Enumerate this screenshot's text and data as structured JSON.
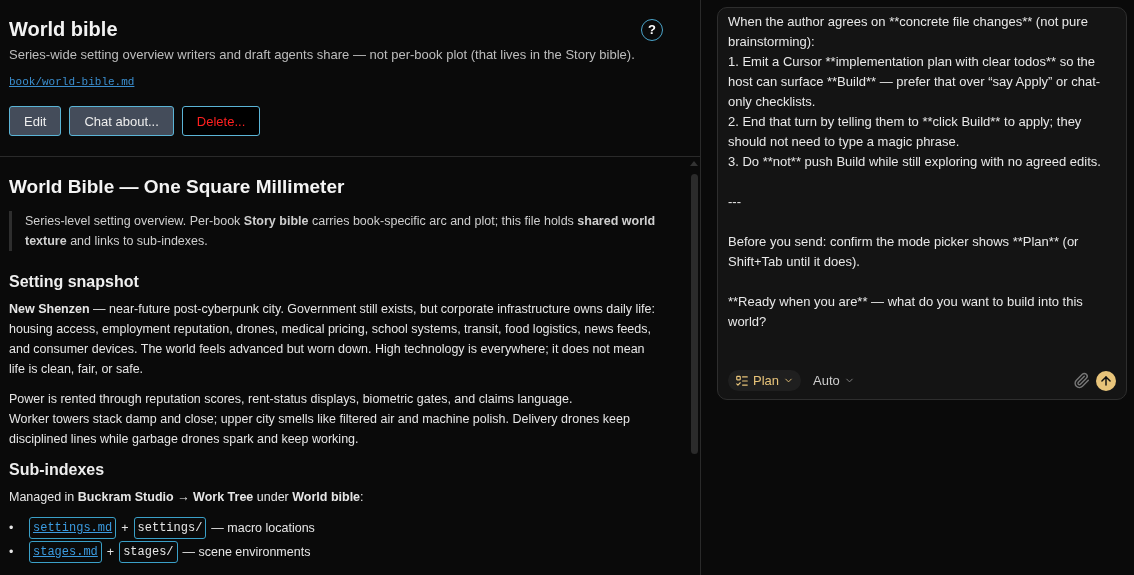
{
  "header": {
    "title": "World bible",
    "subtitle": "Series-wide setting overview writers and draft agents share — not per-book plot (that lives in the Story bible).",
    "path": "book/world-bible.md",
    "help": "?",
    "buttons": [
      {
        "label": "Edit",
        "kind": "normal"
      },
      {
        "label": "Chat about...",
        "kind": "normal"
      },
      {
        "label": "Delete...",
        "kind": "danger"
      }
    ]
  },
  "document": {
    "title": "World Bible — One Square Millimeter",
    "blocks": [
      {
        "kind": "quote",
        "text": "Series-level setting overview. Per-book **Story bible** carries book-specific arc and plot; this file holds **shared world texture** and links to sub-indexes."
      },
      {
        "kind": "heading",
        "text": "Setting snapshot"
      },
      {
        "kind": "paragraph",
        "text": "**New Shenzen** — near-future post-cyberpunk city. Government still exists, but corporate infrastructure owns daily life: housing access, employment reputation, drones, medical pricing, school systems, transit, food logistics, news feeds, and consumer devices. The world feels advanced but worn down. High technology is everywhere; it does not mean life is clean, fair, or safe."
      },
      {
        "kind": "paragraph",
        "text": "Power is rented through reputation scores, rent-status displays, biometric gates, and claims language.\nWorker towers stack damp and close; upper city smells like filtered air and machine polish. Delivery drones keep disciplined lines while garbage drones spark and keep working."
      },
      {
        "kind": "heading",
        "text": "Sub-indexes"
      },
      {
        "kind": "paragraph",
        "text": "Managed in **Buckram Studio → Work Tree** under **World bible**:"
      },
      {
        "kind": "list",
        "items": [
          {
            "bullet": "•",
            "parts": [
              {
                "kind": "link",
                "text": "settings.md"
              },
              {
                "kind": "text",
                "text": "+"
              },
              {
                "kind": "code",
                "text": "settings/"
              },
              {
                "kind": "text",
                "text": "— macro locations"
              }
            ]
          },
          {
            "bullet": "•",
            "parts": [
              {
                "kind": "link",
                "text": "stages.md"
              },
              {
                "kind": "text",
                "text": "+"
              },
              {
                "kind": "code",
                "text": "stages/"
              },
              {
                "kind": "text",
                "text": "— scene environments"
              }
            ]
          }
        ]
      }
    ]
  },
  "composer": {
    "blocks": [
      "When the author agrees on **concrete file changes** (not pure brainstorming):\n1. Emit a Cursor **implementation plan with clear todos** so the host can surface **Build** — prefer that over “say Apply” or chat-only checklists.\n2. End that turn by telling them to **click Build** to apply; they should not need to type a magic phrase.\n3. Do **not** push Build while still exploring with no agreed edits.",
      "---",
      "Before you send: confirm the mode picker shows **Plan** (or Shift+Tab until it does).",
      "**Ready when you are** — what do you want to build into this world?"
    ],
    "mode": "Plan",
    "model": "Auto"
  }
}
